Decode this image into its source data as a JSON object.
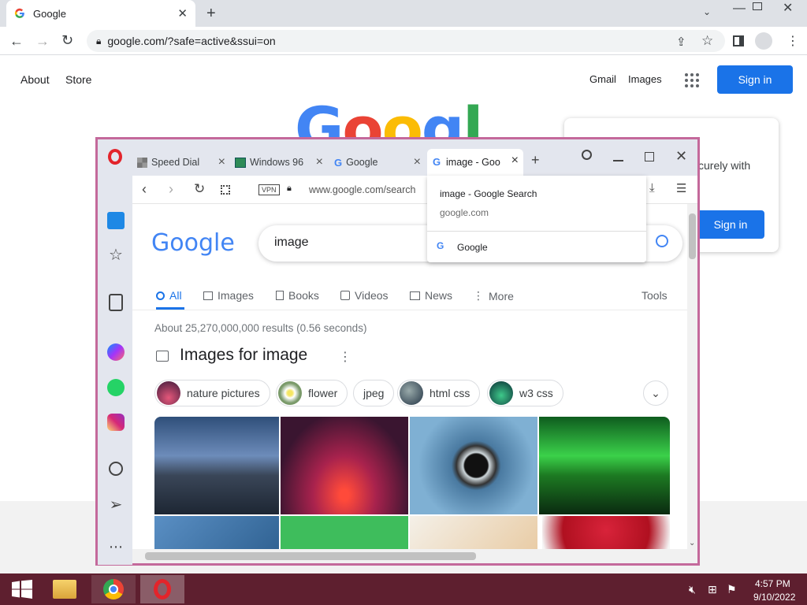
{
  "chrome": {
    "tab_title": "Google",
    "url": "google.com/?safe=active&ssui=on",
    "header_links": {
      "about": "About",
      "store": "Store",
      "gmail": "Gmail",
      "images": "Images"
    },
    "signin": "Sign in",
    "logo_fragment": "Googl",
    "popup_text": "curely with",
    "popup_signin": "Sign in"
  },
  "opera": {
    "tabs": [
      {
        "label": "Speed Dial",
        "icon": "grid-icon"
      },
      {
        "label": "Windows 96",
        "icon": "windows96-icon"
      },
      {
        "label": "Google",
        "icon": "google-g-icon"
      },
      {
        "label": "image - Goo",
        "icon": "google-g-icon"
      }
    ],
    "vpn_badge": "VPN",
    "address": "www.google.com/search",
    "suggestions": [
      {
        "title": "image - Google Search",
        "sub": "google.com"
      },
      {
        "title": "Google"
      }
    ],
    "page": {
      "logo": "Google",
      "query": "image",
      "nav_tabs": [
        "All",
        "Images",
        "Books",
        "Videos",
        "News",
        "More"
      ],
      "tools": "Tools",
      "results_stats": "About 25,270,000,000 results (0.56 seconds)",
      "images_heading": "Images for image",
      "chips": [
        "nature pictures",
        "flower",
        "jpeg",
        "html css",
        "w3 css"
      ]
    }
  },
  "taskbar": {
    "time": "4:57 PM",
    "date": "9/10/2022"
  },
  "colors": {
    "google_blue": "#4285F4",
    "google_red": "#EA4335",
    "google_yellow": "#FBBC05",
    "google_green": "#34A853",
    "opera_frame": "#c4699b",
    "taskbar": "#5e1f2f",
    "signin_blue": "#1a73e8"
  }
}
